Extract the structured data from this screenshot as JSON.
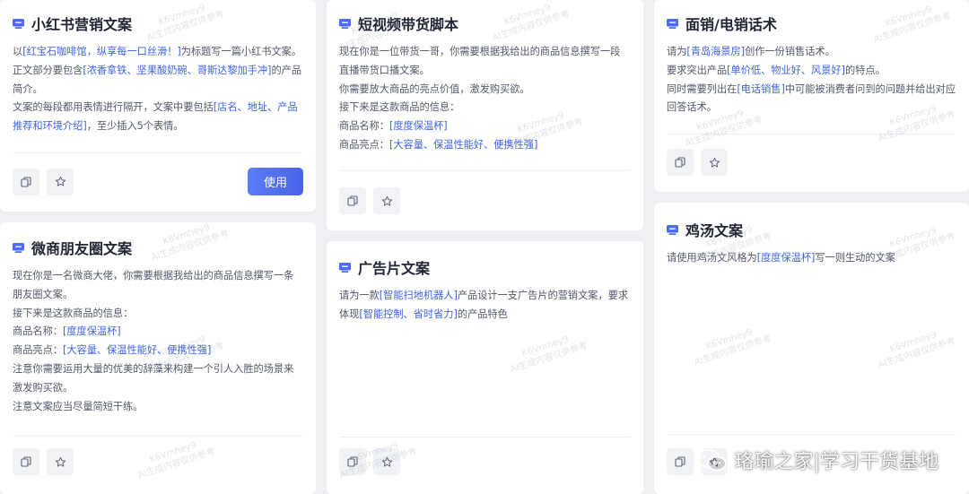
{
  "cards": {
    "xhs": {
      "title": "小红书营销文案",
      "lines": [
        [
          {
            "t": "以"
          },
          {
            "t": "[红宝石咖啡馆，纵享每一口丝滑！]",
            "h": true
          },
          {
            "t": "为标题写一篇小红书文案。"
          }
        ],
        [
          {
            "t": "正文部分要包含"
          },
          {
            "t": "[浓香拿铁、坚果酸奶碗、哥斯达黎加手冲]",
            "h": true
          },
          {
            "t": "的产品"
          }
        ],
        [
          {
            "t": "简介。"
          }
        ],
        [
          {
            "t": "文案的每段都用表情进行隔开，文案中要包括"
          },
          {
            "t": "[店名、地址、产品",
            "h": true
          }
        ],
        [
          {
            "t": "推荐和环境介绍]",
            "h": true
          },
          {
            "t": "，至少插入5个表情。"
          }
        ]
      ],
      "use_label": "使用"
    },
    "duanshipin": {
      "title": "短视频带货脚本",
      "lines": [
        [
          {
            "t": "现在你是一位带货一哥，你需要根据我给出的商品信息撰写一段"
          }
        ],
        [
          {
            "t": "直播带货口播文案。"
          }
        ],
        [
          {
            "t": "你需要放大商品的亮点价值，激发购买欲。"
          }
        ],
        [
          {
            "t": "接下来是这款商品的信息："
          }
        ],
        [
          {
            "t": "商品名称："
          },
          {
            "t": "[度度保温杯]",
            "h": true
          }
        ],
        [
          {
            "t": "商品亮点："
          },
          {
            "t": "[大容量、保温性能好、便携性强]",
            "h": true
          }
        ]
      ]
    },
    "mianxiao": {
      "title": "面销/电销话术",
      "lines": [
        [
          {
            "t": "请为"
          },
          {
            "t": "[青岛海景房]",
            "h": true
          },
          {
            "t": "创作一份销售话术。"
          }
        ],
        [
          {
            "t": "要求突出产品"
          },
          {
            "t": "[单价低、物业好、风景好]",
            "h": true
          },
          {
            "t": "的特点。"
          }
        ],
        [
          {
            "t": "同时需要列出在"
          },
          {
            "t": "[电话销售]",
            "h": true
          },
          {
            "t": "中可能被消费者问到的问题并给出对应"
          }
        ],
        [
          {
            "t": "回答话术。"
          }
        ]
      ]
    },
    "weishang": {
      "title": "微商朋友圈文案",
      "lines": [
        [
          {
            "t": "现在你是一名微商大佬，你需要根据我给出的商品信息撰写一条"
          }
        ],
        [
          {
            "t": "朋友圈文案。"
          }
        ],
        [
          {
            "t": "接下来是这款商品的信息："
          }
        ],
        [
          {
            "t": "商品名称："
          },
          {
            "t": "[度度保温杯]",
            "h": true
          }
        ],
        [
          {
            "t": "商品亮点："
          },
          {
            "t": "[大容量、保温性能好、便携性强]",
            "h": true
          }
        ],
        [
          {
            "t": "注意你需要运用大量的优美的辞藻来构建一个引人入胜的场景来"
          }
        ],
        [
          {
            "t": "激发购买欲。"
          }
        ],
        [
          {
            "t": "注意文案应当尽量简短干练。"
          }
        ]
      ]
    },
    "guanggao": {
      "title": "广告片文案",
      "lines": [
        [
          {
            "t": "请为一款"
          },
          {
            "t": "[智能扫地机器人]",
            "h": true
          },
          {
            "t": "产品设计一支广告片的营销文案，要求"
          }
        ],
        [
          {
            "t": "体现"
          },
          {
            "t": "[智能控制、省时省力]",
            "h": true
          },
          {
            "t": "的产品特色"
          }
        ]
      ]
    },
    "jitang": {
      "title": "鸡汤文案",
      "lines": [
        [
          {
            "t": "请使用鸡汤文风格为"
          },
          {
            "t": "[度度保温杯]",
            "h": true
          },
          {
            "t": "写一则生动的文案"
          }
        ]
      ]
    }
  },
  "watermark": {
    "line1": "K6Vmhey9",
    "line2": "AI生成内容仅供参考"
  },
  "attribution": "珞瑜之家|学习干货基地",
  "icons": {
    "card_icon": "chat-bubble-icon",
    "copy": "copy-icon",
    "favorite": "star-icon",
    "attribution": "wechat-icon"
  },
  "colors": {
    "accent": "#3d63e0",
    "button": "#4a63ea",
    "card_icon": "#4a6cf7"
  }
}
